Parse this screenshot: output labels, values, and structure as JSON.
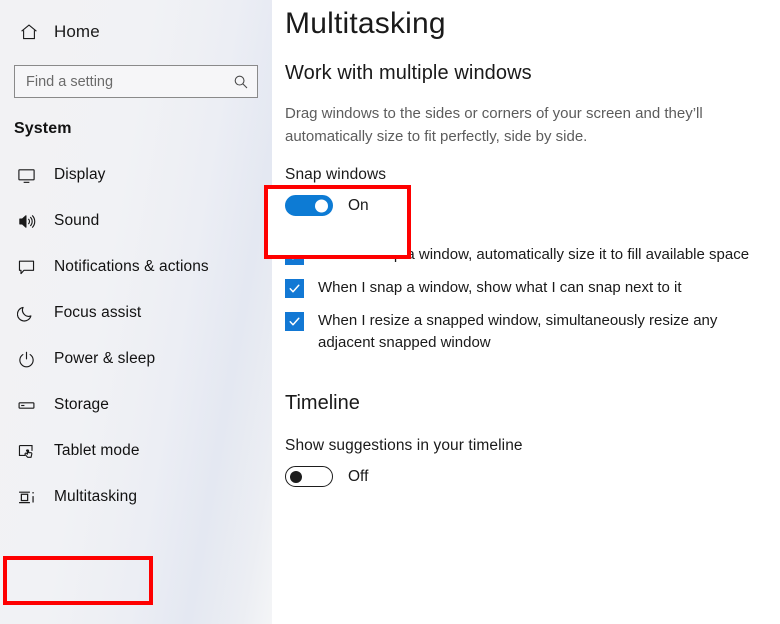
{
  "sidebar": {
    "home": {
      "label": "Home",
      "icon": "home-icon"
    },
    "search": {
      "value": "",
      "placeholder": "Find a setting",
      "icon": "search-icon"
    },
    "section_title": "System",
    "items": [
      {
        "label": "Display",
        "icon": "monitor-icon",
        "selected": false
      },
      {
        "label": "Sound",
        "icon": "speaker-icon",
        "selected": false
      },
      {
        "label": "Notifications & actions",
        "icon": "chat-bubble-icon",
        "selected": false
      },
      {
        "label": "Focus assist",
        "icon": "moon-icon",
        "selected": false
      },
      {
        "label": "Power & sleep",
        "icon": "power-icon",
        "selected": false
      },
      {
        "label": "Storage",
        "icon": "drive-icon",
        "selected": false
      },
      {
        "label": "Tablet mode",
        "icon": "tablet-hand-icon",
        "selected": false
      },
      {
        "label": "Multitasking",
        "icon": "task-view-icon",
        "selected": true
      }
    ]
  },
  "main": {
    "page_title": "Multitasking",
    "groups": [
      {
        "title": "Work with multiple windows",
        "description": "Drag windows to the sides or corners of your screen and they’ll automatically size to fit perfectly, side by side.",
        "setting_label": "Snap windows",
        "toggle": {
          "state_label": "On",
          "checked": true
        },
        "checkboxes": [
          {
            "label": "When I snap a window, automatically size it to fill available space",
            "checked": true
          },
          {
            "label": "When I snap a window, show what I can snap next to it",
            "checked": true
          },
          {
            "label": "When I resize a snapped window, simultaneously resize any adjacent snapped window",
            "checked": true
          }
        ]
      },
      {
        "title": "Timeline",
        "setting_label": "Show suggestions in your timeline",
        "toggle": {
          "state_label": "Off",
          "checked": false
        }
      }
    ]
  },
  "highlights": {
    "accent_color": "#fe0000",
    "toggle_on_color": "#0d7bd4",
    "checkbox_color": "#1278d4",
    "boxes": [
      {
        "target": "sidebar-item-multitasking"
      },
      {
        "target": "snap-windows-setting"
      }
    ]
  }
}
